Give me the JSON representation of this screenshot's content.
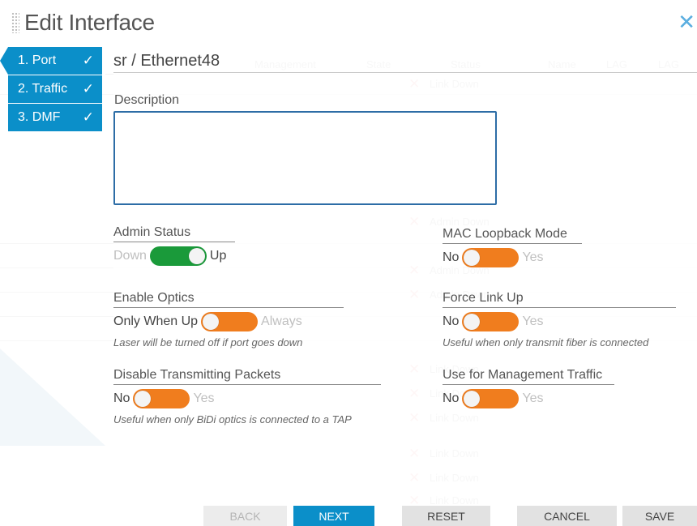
{
  "dialog": {
    "title": "Edit Interface",
    "port_name": "sr / Ethernet48"
  },
  "steps": [
    {
      "label": "1. Port"
    },
    {
      "label": "2. Traffic"
    },
    {
      "label": "3. DMF"
    }
  ],
  "description": {
    "label": "Description",
    "value": ""
  },
  "admin_status": {
    "label": "Admin Status",
    "off_label": "Down",
    "on_label": "Up",
    "state": "on"
  },
  "enable_optics": {
    "label": "Enable Optics",
    "off_label": "Only When Up",
    "on_label": "Always",
    "state": "off",
    "hint": "Laser will be turned off if port goes down"
  },
  "disable_transmitting": {
    "label": "Disable Transmitting Packets",
    "off_label": "No",
    "on_label": "Yes",
    "state": "off",
    "hint": "Useful when only BiDi optics is connected to a TAP"
  },
  "mac_loopback": {
    "label": "MAC Loopback Mode",
    "off_label": "No",
    "on_label": "Yes",
    "state": "off"
  },
  "force_link_up": {
    "label": "Force Link Up",
    "off_label": "No",
    "on_label": "Yes",
    "state": "off",
    "hint": "Useful when only transmit fiber is connected"
  },
  "management_traffic": {
    "label": "Use for Management Traffic",
    "off_label": "No",
    "on_label": "Yes",
    "state": "off"
  },
  "footer": {
    "back": "BACK",
    "next": "NEXT",
    "reset": "RESET",
    "cancel": "CANCEL",
    "save": "SAVE"
  },
  "background": {
    "columns": [
      "Management",
      "State",
      "Status",
      "Name",
      "LAG",
      "LAG"
    ],
    "statuses": [
      "Link Down",
      "Admin Down",
      "Admin Down",
      "Admin Down",
      "Link Down",
      "Link Down",
      "Link Down",
      "Link Down",
      "Link Down",
      "Link Down"
    ]
  },
  "colors": {
    "accent": "#0b8fc9",
    "switch_on": "#1a9a3a",
    "switch_off": "#f07d1e",
    "focus_border": "#2d6da6"
  },
  "icons": {
    "step_check": "✓",
    "close": "✕"
  }
}
